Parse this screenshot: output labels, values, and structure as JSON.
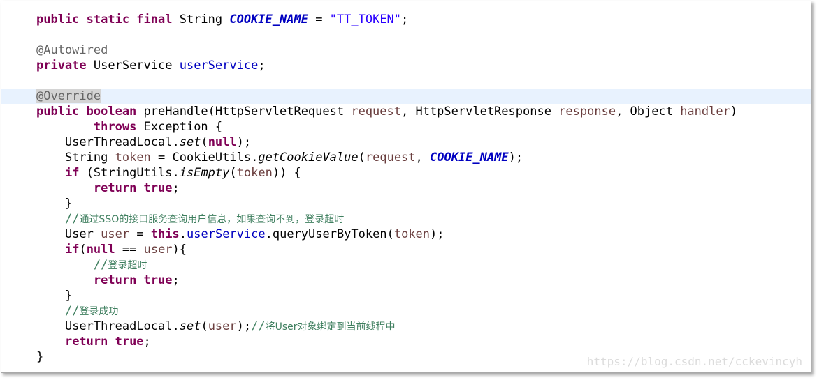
{
  "code": {
    "l1": {
      "kw": "public static final",
      "type": " String ",
      "const": "COOKIE_NAME",
      "eq": " = ",
      "str": "\"TT_TOKEN\"",
      "semi": ";"
    },
    "l3": {
      "ann": "@Autowired"
    },
    "l4": {
      "kw": "private",
      "type": " UserService ",
      "field": "userService",
      "semi": ";"
    },
    "l6": {
      "ann": "@Override"
    },
    "l7": {
      "kw": "public boolean",
      "m": " preHandle(HttpServletRequest ",
      "p1": "request",
      "m2": ", HttpServletResponse ",
      "p2": "response",
      "m3": ", Object ",
      "p3": "handler",
      "m4": ")"
    },
    "l8": {
      "kw": "throws",
      "rest": " Exception {"
    },
    "l9": {
      "a": "UserThreadLocal.",
      "call": "set",
      "b": "(",
      "kw": "null",
      "c": ");"
    },
    "l10": {
      "a": "String ",
      "lv": "token",
      "b": " = CookieUtils.",
      "call": "getCookieValue",
      "c": "(",
      "p": "request",
      "d": ", ",
      "const": "COOKIE_NAME",
      "e": ");"
    },
    "l11": {
      "kw": "if",
      "a": " (StringUtils.",
      "call": "isEmpty",
      "b": "(",
      "lv": "token",
      "c": ")) {"
    },
    "l12": {
      "kw": "return true",
      "semi": ";"
    },
    "l13": {
      "t": "}"
    },
    "l14": {
      "slash": "//",
      "text": "通过SSO的接口服务查询用户信息，如果查询不到，登录超时"
    },
    "l15": {
      "a": "User ",
      "lv": "user",
      "b": " = ",
      "kw": "this",
      "c": ".",
      "field": "userService",
      "d": ".queryUserByToken(",
      "lv2": "token",
      "e": ");"
    },
    "l16": {
      "kw": "if",
      "a": "(",
      "kw2": "null",
      "b": " == ",
      "lv": "user",
      "c": "){"
    },
    "l17": {
      "slash": "//",
      "text": "登录超时"
    },
    "l18": {
      "kw": "return true",
      "semi": ";"
    },
    "l19": {
      "t": "}"
    },
    "l20": {
      "slash": "//",
      "text": "登录成功"
    },
    "l21": {
      "a": "UserThreadLocal.",
      "call": "set",
      "b": "(",
      "lv": "user",
      "c": ");",
      "cslash": "//",
      "ctext": "将User对象绑定到当前线程中"
    },
    "l22": {
      "kw": "return true",
      "semi": ";"
    },
    "l23": {
      "t": "}"
    }
  },
  "watermark": "https://blog.csdn.net/cckevincyh"
}
